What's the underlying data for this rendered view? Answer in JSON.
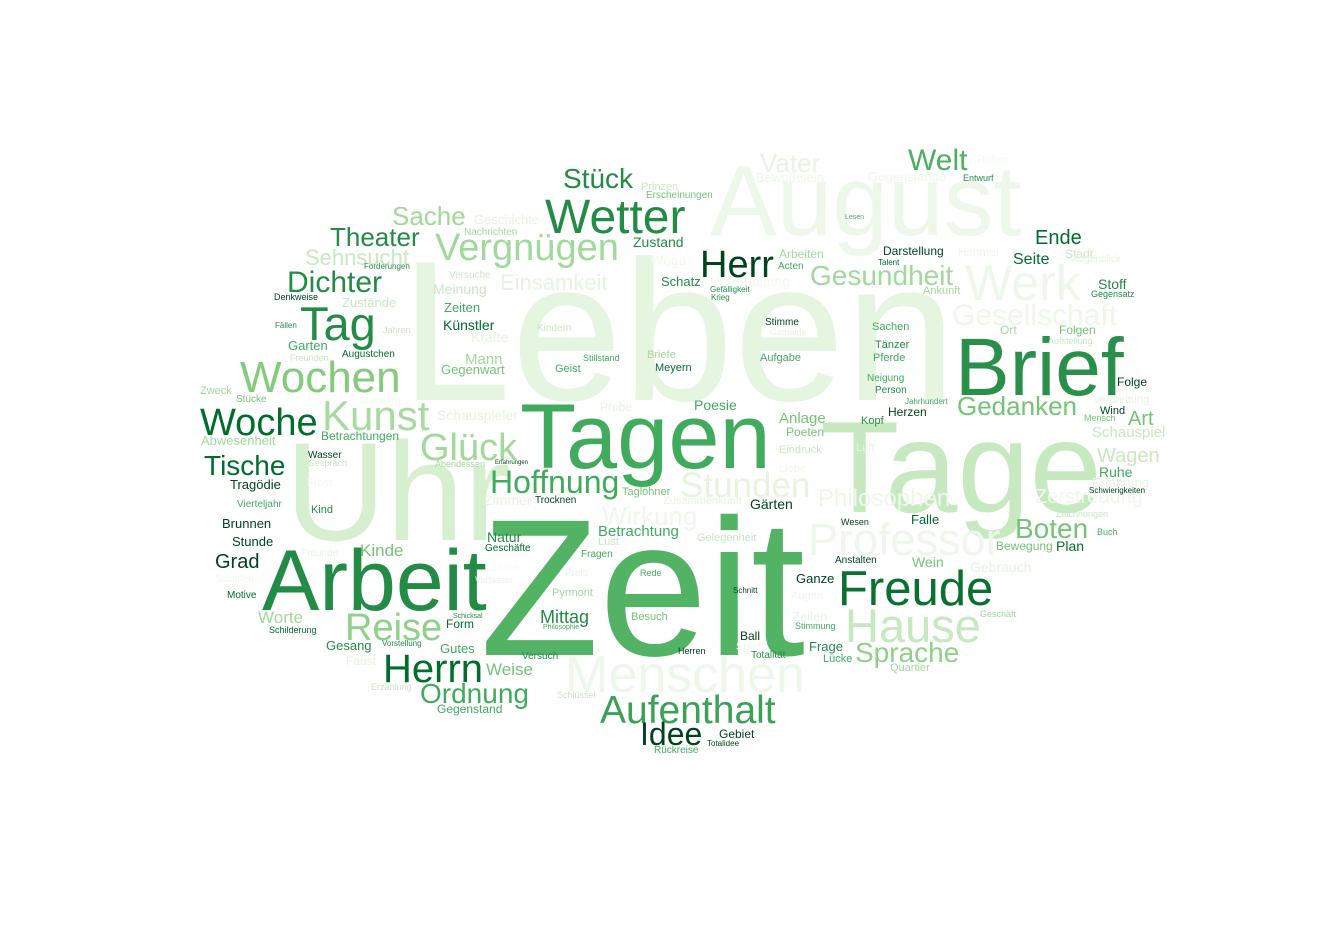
{
  "palette": [
    "#00441b",
    "#006d2c",
    "#238b45",
    "#41ab5d",
    "#74c476",
    "#a1d99b",
    "#c7e9c0",
    "#e5f5e0",
    "#f0f9ed"
  ],
  "words": [
    {
      "text": "Leben",
      "color": "#e5f5e0"
    },
    {
      "text": "August",
      "color": "#edf8ea"
    },
    {
      "text": "Uhr",
      "color": "#d5efcf"
    },
    {
      "text": "Tage",
      "color": "#c7e9c0"
    },
    {
      "text": "Werk",
      "color": "#edf8ea"
    },
    {
      "text": "Menschen",
      "color": "#edf8ea"
    },
    {
      "text": "Professor",
      "color": "#edf8ea"
    },
    {
      "text": "Hause",
      "color": "#c7e9c0"
    },
    {
      "text": "Stunden",
      "color": "#e5f5e0"
    },
    {
      "text": "Gesellschaft",
      "color": "#edf8ea"
    },
    {
      "text": "Philosophen",
      "color": "#edf8ea"
    },
    {
      "text": "Wirkung",
      "color": "#edf8ea"
    },
    {
      "text": "Zerstreuung",
      "color": "#f0f9ed"
    },
    {
      "text": "Einsamkeit",
      "color": "#e5f5e0"
    },
    {
      "text": "Unterhaltung",
      "color": "#f0f9ed"
    },
    {
      "text": "Wege",
      "color": "#f0f9ed"
    },
    {
      "text": "Zeit",
      "color": "#52b365"
    },
    {
      "text": "Tagen",
      "color": "#41ab5d"
    },
    {
      "text": "Arbeit",
      "color": "#238b45"
    },
    {
      "text": "Brief",
      "color": "#2a8f4a"
    },
    {
      "text": "Freude",
      "color": "#0a7030"
    },
    {
      "text": "Wetter",
      "color": "#238b45"
    },
    {
      "text": "Herr",
      "color": "#00441b"
    },
    {
      "text": "Tag",
      "color": "#238b45"
    },
    {
      "text": "Wochen",
      "color": "#85cb7c"
    },
    {
      "text": "Woche",
      "color": "#006d2c"
    },
    {
      "text": "Kunst",
      "color": "#a8dba0"
    },
    {
      "text": "Glück",
      "color": "#a1d99b"
    },
    {
      "text": "Reise",
      "color": "#8fd08a"
    },
    {
      "text": "Herrn",
      "color": "#006d2c"
    },
    {
      "text": "Aufenthalt",
      "color": "#3aa157"
    },
    {
      "text": "Idee",
      "color": "#00441b"
    },
    {
      "text": "Ordnung",
      "color": "#41ab5d"
    },
    {
      "text": "Sprache",
      "color": "#8fd08a"
    },
    {
      "text": "Hoffnung",
      "color": "#41ab5d"
    },
    {
      "text": "Vergnügen",
      "color": "#a1d99b"
    },
    {
      "text": "Stück",
      "color": "#238b45"
    },
    {
      "text": "Gesundheit",
      "color": "#a1d99b"
    },
    {
      "text": "Welt",
      "color": "#4daf62"
    },
    {
      "text": "Vater",
      "color": "#e5f5e0"
    },
    {
      "text": "Dichter",
      "color": "#238b45"
    },
    {
      "text": "Theater",
      "color": "#238b45"
    },
    {
      "text": "Sache",
      "color": "#a1d99b"
    },
    {
      "text": "Sehnsucht",
      "color": "#c7e9c0"
    },
    {
      "text": "Tische",
      "color": "#006d2c"
    },
    {
      "text": "Gedanken",
      "color": "#74c476"
    },
    {
      "text": "Boten",
      "color": "#74c476"
    },
    {
      "text": "Wagen",
      "color": "#c7e9c0"
    },
    {
      "text": "Schauspiel",
      "color": "#c7e9c0"
    },
    {
      "text": "Art",
      "color": "#74c476"
    },
    {
      "text": "Ende",
      "color": "#006d2c"
    },
    {
      "text": "Seite",
      "color": "#006d2c"
    },
    {
      "text": "Stadt",
      "color": "#c7e9c0"
    },
    {
      "text": "Augenblick",
      "color": "#e5f5e0"
    },
    {
      "text": "Stoff",
      "color": "#238b45"
    },
    {
      "text": "Gegensatz",
      "color": "#238b45"
    },
    {
      "text": "Folgen",
      "color": "#74c476"
    },
    {
      "text": "Aufstellung",
      "color": "#c7e9c0"
    },
    {
      "text": "Ort",
      "color": "#a1d99b"
    },
    {
      "text": "Folge",
      "color": "#00441b"
    },
    {
      "text": "Wind",
      "color": "#00441b"
    },
    {
      "text": "Mensch",
      "color": "#74c476"
    },
    {
      "text": "Verbreitung",
      "color": "#e5f5e0"
    },
    {
      "text": "Ruhe",
      "color": "#41ab5d"
    },
    {
      "text": "Erfahrung",
      "color": "#e5f5e0"
    },
    {
      "text": "Schwierigkeiten",
      "color": "#00441b"
    },
    {
      "text": "Zeichnungen",
      "color": "#c7e9c0"
    },
    {
      "text": "Buch",
      "color": "#41ab5d"
    },
    {
      "text": "Bewegung",
      "color": "#74c476"
    },
    {
      "text": "Plan",
      "color": "#006d2c"
    },
    {
      "text": "Falle",
      "color": "#006d2c"
    },
    {
      "text": "Wesen",
      "color": "#00441b"
    },
    {
      "text": "Anstalten",
      "color": "#00441b"
    },
    {
      "text": "Wein",
      "color": "#74c476"
    },
    {
      "text": "Gebrauch",
      "color": "#e5f5e0"
    },
    {
      "text": "Geschäft",
      "color": "#a1d99b"
    },
    {
      "text": "Ganze",
      "color": "#00441b"
    },
    {
      "text": "Schnitt",
      "color": "#00441b"
    },
    {
      "text": "Zeilen",
      "color": "#e5f5e0"
    },
    {
      "text": "Stimmung",
      "color": "#41ab5d"
    },
    {
      "text": "Frage",
      "color": "#238b45"
    },
    {
      "text": "Lücke",
      "color": "#41ab5d"
    },
    {
      "text": "Totalität",
      "color": "#238b45"
    },
    {
      "text": "Ball",
      "color": "#00441b"
    },
    {
      "text": "Herren",
      "color": "#00441b"
    },
    {
      "text": "Quartier",
      "color": "#a1d99b"
    },
    {
      "text": "Besuch",
      "color": "#74c476"
    },
    {
      "text": "Rede",
      "color": "#41ab5d"
    },
    {
      "text": "Gelegenheit",
      "color": "#c7e9c0"
    },
    {
      "text": "Betrachtung",
      "color": "#41ab5d"
    },
    {
      "text": "Lust",
      "color": "#c7e9c0"
    },
    {
      "text": "Fragen",
      "color": "#41ab5d"
    },
    {
      "text": "Zusammenkunft",
      "color": "#e5f5e0"
    },
    {
      "text": "Taglöhner",
      "color": "#74c476"
    },
    {
      "text": "Gärten",
      "color": "#00441b"
    },
    {
      "text": "Eindruck",
      "color": "#c7e9c0"
    },
    {
      "text": "Poeten",
      "color": "#74c476"
    },
    {
      "text": "Anlage",
      "color": "#74c476"
    },
    {
      "text": "Poesie",
      "color": "#41ab5d"
    },
    {
      "text": "Probe",
      "color": "#e5f5e0"
    },
    {
      "text": "Kopf",
      "color": "#238b45"
    },
    {
      "text": "Herzen",
      "color": "#00441b"
    },
    {
      "text": "Jahrhundert",
      "color": "#41ab5d"
    },
    {
      "text": "Neigung",
      "color": "#41ab5d"
    },
    {
      "text": "Person",
      "color": "#238b45"
    },
    {
      "text": "Sachen",
      "color": "#41ab5d"
    },
    {
      "text": "Tänzer",
      "color": "#238b45"
    },
    {
      "text": "Pferde",
      "color": "#41ab5d"
    },
    {
      "text": "Stimme",
      "color": "#00441b"
    },
    {
      "text": "Gemälde",
      "color": "#e5f5e0"
    },
    {
      "text": "Aufgabe",
      "color": "#41ab5d"
    },
    {
      "text": "Meyern",
      "color": "#006d2c"
    },
    {
      "text": "Briefe",
      "color": "#a1d99b"
    },
    {
      "text": "Stillstand",
      "color": "#41ab5d"
    },
    {
      "text": "Geist",
      "color": "#41ab5d"
    },
    {
      "text": "Gegenwart",
      "color": "#74c476"
    },
    {
      "text": "Mann",
      "color": "#a1d99b"
    },
    {
      "text": "Augustchen",
      "color": "#006d2c"
    },
    {
      "text": "Garten",
      "color": "#41ab5d"
    },
    {
      "text": "Freunden",
      "color": "#c7e9c0"
    },
    {
      "text": "Künstler",
      "color": "#006d2c"
    },
    {
      "text": "Zeiten",
      "color": "#41ab5d"
    },
    {
      "text": "Kindern",
      "color": "#c7e9c0"
    },
    {
      "text": "Kräfte",
      "color": "#e5f5e0"
    },
    {
      "text": "Zustände",
      "color": "#c7e9c0"
    },
    {
      "text": "Jahren",
      "color": "#c7e9c0"
    },
    {
      "text": "Fällen",
      "color": "#238b45"
    },
    {
      "text": "Denkweise",
      "color": "#00441b"
    },
    {
      "text": "Meinung",
      "color": "#c7e9c0"
    },
    {
      "text": "Versuche",
      "color": "#c7e9c0"
    },
    {
      "text": "Forderungen",
      "color": "#238b45"
    },
    {
      "text": "Geschichte",
      "color": "#e5f5e0"
    },
    {
      "text": "Nachrichten",
      "color": "#a1d99b"
    },
    {
      "text": "Zustand",
      "color": "#238b45"
    },
    {
      "text": "Schatz",
      "color": "#238b45"
    },
    {
      "text": "Gefälligkeit",
      "color": "#238b45"
    },
    {
      "text": "Krieg",
      "color": "#238b45"
    },
    {
      "text": "Prinzen",
      "color": "#c7e9c0"
    },
    {
      "text": "Erscheinungen",
      "color": "#74c476"
    },
    {
      "text": "Bewußtsein",
      "color": "#edf8ea"
    },
    {
      "text": "Gegenstände",
      "color": "#edf8ea"
    },
    {
      "text": "Entwurf",
      "color": "#238b45"
    },
    {
      "text": "Rollen",
      "color": "#f0f9ed"
    },
    {
      "text": "Darstellung",
      "color": "#00441b"
    },
    {
      "text": "Talent",
      "color": "#006d2c"
    },
    {
      "text": "Himmel",
      "color": "#edf8ea"
    },
    {
      "text": "Ankunft",
      "color": "#a1d99b"
    },
    {
      "text": "Arbeiten",
      "color": "#a1d99b"
    },
    {
      "text": "Acten",
      "color": "#41ab5d"
    },
    {
      "text": "Lesen",
      "color": "#41ab5d"
    },
    {
      "text": "Zweck",
      "color": "#a1d99b"
    },
    {
      "text": "Stücke",
      "color": "#74c476"
    },
    {
      "text": "Maximen",
      "color": "#f0f9ed"
    },
    {
      "text": "Schauspieler",
      "color": "#e5f5e0"
    },
    {
      "text": "Betrachtungen",
      "color": "#41ab5d"
    },
    {
      "text": "Abwesenheit",
      "color": "#a1d99b"
    },
    {
      "text": "Wasser",
      "color": "#00441b"
    },
    {
      "text": "Gespräch",
      "color": "#c7e9c0"
    },
    {
      "text": "Abendessen",
      "color": "#a1d99b"
    },
    {
      "text": "Erfahrungen",
      "color": "#00441b"
    },
    {
      "text": "Tragödie",
      "color": "#00441b"
    },
    {
      "text": "Frost",
      "color": "#f0f9ed"
    },
    {
      "text": "Vierteljahr",
      "color": "#41ab5d"
    },
    {
      "text": "Kind",
      "color": "#238b45"
    },
    {
      "text": "Brunnen",
      "color": "#00441b"
    },
    {
      "text": "Stunde",
      "color": "#00441b"
    },
    {
      "text": "Grad",
      "color": "#00441b"
    },
    {
      "text": "Kinde",
      "color": "#74c476"
    },
    {
      "text": "Freunde",
      "color": "#e5f5e0"
    },
    {
      "text": "Schlafen",
      "color": "#f0f9ed"
    },
    {
      "text": "Motive",
      "color": "#006d2c"
    },
    {
      "text": "Worte",
      "color": "#a1d99b"
    },
    {
      "text": "Schilderung",
      "color": "#006d2c"
    },
    {
      "text": "Gesang",
      "color": "#238b45"
    },
    {
      "text": "Vorstellung",
      "color": "#238b45"
    },
    {
      "text": "Faust",
      "color": "#e5f5e0"
    },
    {
      "text": "Erzählung",
      "color": "#c7e9c0"
    },
    {
      "text": "Gutes",
      "color": "#41ab5d"
    },
    {
      "text": "Weise",
      "color": "#74c476"
    },
    {
      "text": "Versuch",
      "color": "#238b45"
    },
    {
      "text": "Schlüssel",
      "color": "#c7e9c0"
    },
    {
      "text": "Gegenstand",
      "color": "#41ab5d"
    },
    {
      "text": "Natur",
      "color": "#238b45"
    },
    {
      "text": "Geschäfte",
      "color": "#006d2c"
    },
    {
      "text": "Zimmer",
      "color": "#e5f5e0"
    },
    {
      "text": "Trocknen",
      "color": "#00441b"
    },
    {
      "text": "Schicksal",
      "color": "#238b45"
    },
    {
      "text": "Form",
      "color": "#006d2c"
    },
    {
      "text": "Verfasser",
      "color": "#e5f5e0"
    },
    {
      "text": "Mittag",
      "color": "#238b45"
    },
    {
      "text": "Philosophie",
      "color": "#41ab5d"
    },
    {
      "text": "Pyrmont",
      "color": "#a1d99b"
    },
    {
      "text": "Sinne",
      "color": "#f5fbf3"
    },
    {
      "text": "Preis",
      "color": "#e5f5e0"
    },
    {
      "text": "Gebiet",
      "color": "#00441b"
    },
    {
      "text": "Totalidee",
      "color": "#00441b"
    },
    {
      "text": "Rückreise",
      "color": "#41ab5d"
    },
    {
      "text": "Spiel",
      "color": "#edf8ea"
    },
    {
      "text": "Augen",
      "color": "#edf8ea"
    },
    {
      "text": "Liebe",
      "color": "#f0f9ed"
    },
    {
      "text": "Luft",
      "color": "#e5f5e0"
    }
  ]
}
